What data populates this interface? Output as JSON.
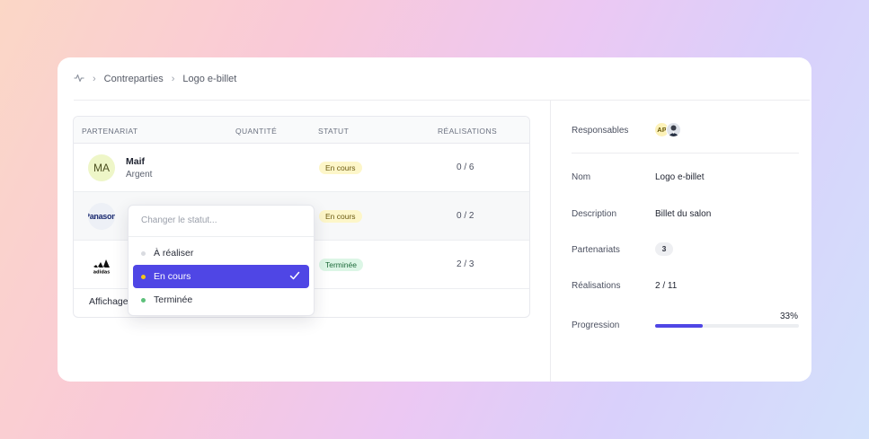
{
  "breadcrumb": {
    "items": [
      "Contreparties",
      "Logo e-billet"
    ]
  },
  "table": {
    "headers": [
      "Partenariat",
      "Quantité",
      "Statut",
      "Réalisations"
    ],
    "rows": [
      {
        "logo_text": "MA",
        "name": "Maif",
        "level": "Argent",
        "status": "En cours",
        "realisations": "0 / 6"
      },
      {
        "logo_text": "Panasonic",
        "name": "",
        "level": "",
        "status": "En cours",
        "realisations": "0 / 2"
      },
      {
        "logo_text": "adidas",
        "name": "",
        "level": "",
        "status": "Terminée",
        "realisations": "2 / 3"
      }
    ],
    "footer": "Affichage"
  },
  "dropdown": {
    "placeholder": "Changer le statut...",
    "options": [
      {
        "label": "À réaliser",
        "color": "#d9dbe0"
      },
      {
        "label": "En cours",
        "color": "#f5c518",
        "selected": true
      },
      {
        "label": "Terminée",
        "color": "#5cc07a"
      }
    ]
  },
  "details": {
    "responsables_label": "Responsables",
    "responsables": [
      {
        "initials": "AP"
      },
      {
        "initials": ""
      }
    ],
    "nom_label": "Nom",
    "nom": "Logo e-billet",
    "description_label": "Description",
    "description": "Billet du salon",
    "partenariats_label": "Partenariats",
    "partenariats": "3",
    "realisations_label": "Réalisations",
    "realisations": "2 / 11",
    "progression_label": "Progression",
    "progression_pct": "33%",
    "progression_value": 0.33
  },
  "colors": {
    "accent": "#4f46e5",
    "in_progress": "#f5c518",
    "done": "#5cc07a"
  },
  "icons": {
    "breadcrumb_root": "activity-icon",
    "separator": "chevron-right-icon",
    "check": "check-icon"
  }
}
